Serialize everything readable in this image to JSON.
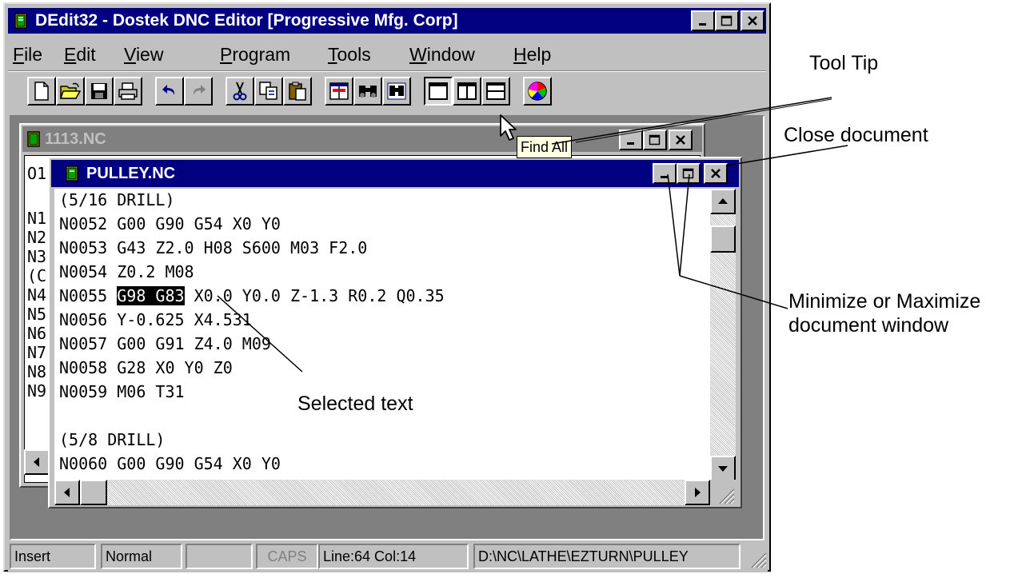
{
  "app": {
    "title": "DEdit32 - Dostek DNC Editor [Progressive Mfg. Corp]"
  },
  "menu": [
    {
      "label": "File",
      "accel": "F",
      "rest": "ile"
    },
    {
      "label": "Edit",
      "accel": "E",
      "rest": "dit"
    },
    {
      "label": "View",
      "accel": "V",
      "rest": "iew"
    },
    {
      "label": "Program",
      "accel": "P",
      "rest": "rogram"
    },
    {
      "label": "Tools",
      "accel": "T",
      "rest": "ools"
    },
    {
      "label": "Window",
      "accel": "W",
      "rest": "indow"
    },
    {
      "label": "Help",
      "accel": "H",
      "rest": "elp"
    }
  ],
  "toolbar": {
    "icons": [
      "new-file-icon",
      "open-folder-icon",
      "save-disk-icon",
      "print-icon",
      "undo-icon",
      "redo-icon",
      "cut-scissors-icon",
      "copy-icon",
      "paste-icon",
      "compare-icon",
      "find-binoculars-icon",
      "find-all-icon",
      "single-view-icon",
      "vertical-split-icon",
      "horizontal-split-icon",
      "color-wheel-icon"
    ],
    "tooltip": "Find All"
  },
  "back_doc": {
    "title": "1113.NC",
    "lines": [
      "O1",
      "",
      "N1",
      "N2",
      "N3",
      "(C",
      "N4",
      "N5",
      "N6",
      "N7",
      "N8",
      "N9"
    ]
  },
  "front_doc": {
    "title": "PULLEY.NC",
    "lines": [
      {
        "pre": "(5/16 DRILL)",
        "sel": "",
        "post": ""
      },
      {
        "pre": "N0052 G00 G90 G54 X0 Y0",
        "sel": "",
        "post": ""
      },
      {
        "pre": "N0053 G43 Z2.0 H08 S600 M03 F2.0",
        "sel": "",
        "post": ""
      },
      {
        "pre": "N0054 Z0.2 M08",
        "sel": "",
        "post": ""
      },
      {
        "pre": "N0055 ",
        "sel": "G98 G83",
        "post": " X0.0 Y0.0 Z-1.3 R0.2 Q0.35"
      },
      {
        "pre": "N0056 Y-0.625 X4.531",
        "sel": "",
        "post": ""
      },
      {
        "pre": "N0057 G00 G91 Z4.0 M09",
        "sel": "",
        "post": ""
      },
      {
        "pre": "N0058 G28 X0 Y0 Z0",
        "sel": "",
        "post": ""
      },
      {
        "pre": "N0059 M06 T31",
        "sel": "",
        "post": ""
      },
      {
        "pre": "",
        "sel": "",
        "post": ""
      },
      {
        "pre": "(5/8 DRILL)",
        "sel": "",
        "post": ""
      },
      {
        "pre": "N0060 G00 G90 G54 X0 Y0",
        "sel": "",
        "post": ""
      }
    ]
  },
  "status": {
    "mode": "Insert",
    "view": "Normal",
    "blank": "",
    "caps": "CAPS",
    "position": "Line:64 Col:14",
    "path": "D:\\NC\\LATHE\\EZTURN\\PULLEY"
  },
  "annotations": {
    "tool_tip": "Tool Tip",
    "close_document": "Close document",
    "minmax_line1": "Minimize or Maximize",
    "minmax_line2": "document window",
    "selected_text": "Selected text"
  },
  "colors": {
    "active_title": "#000080",
    "inactive_title": "#808080",
    "window_face": "#c0c0c0",
    "tooltip_bg": "#ffffe1"
  }
}
